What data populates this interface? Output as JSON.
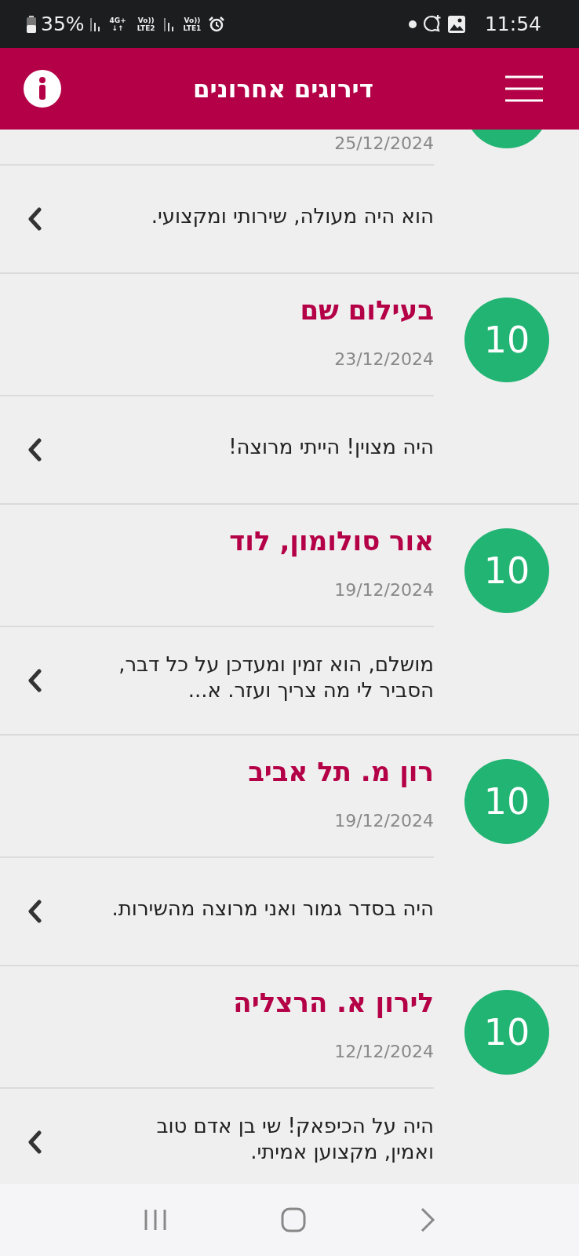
{
  "status_bar": {
    "battery": "35%",
    "data_type": {
      "top": "4G+",
      "bottom": "↓↑"
    },
    "sim_2": {
      "top": "Vo))",
      "bottom": "LTE2"
    },
    "sim_1": {
      "top": "Vo))",
      "bottom": "LTE1"
    },
    "time": "11:54"
  },
  "header": {
    "title": "דירוגים אחרונים"
  },
  "reviews": [
    {
      "kind": "partial",
      "date": "25/12/2024",
      "text": "הוא היה מעולה, שירותי ומקצועי."
    },
    {
      "kind": "full",
      "score": "10",
      "name": "בעילום שם",
      "date": "23/12/2024",
      "text": "היה מצוין! הייתי מרוצה!"
    },
    {
      "kind": "full",
      "score": "10",
      "name": "אור סולומון, לוד",
      "date": "19/12/2024",
      "text": "מושלם, הוא זמין ומעדכן על כל דבר, הסביר לי מה צריך ועזר. א..."
    },
    {
      "kind": "full",
      "score": "10",
      "name": "רון מ. תל אביב",
      "date": "19/12/2024",
      "text": "היה בסדר גמור ואני מרוצה מהשירות."
    },
    {
      "kind": "full",
      "score": "10",
      "name": "לירון א. הרצליה",
      "date": "12/12/2024",
      "text": "היה על הכיפאק! שי בן אדם טוב ואמין, מקצוען אמיתי."
    }
  ]
}
